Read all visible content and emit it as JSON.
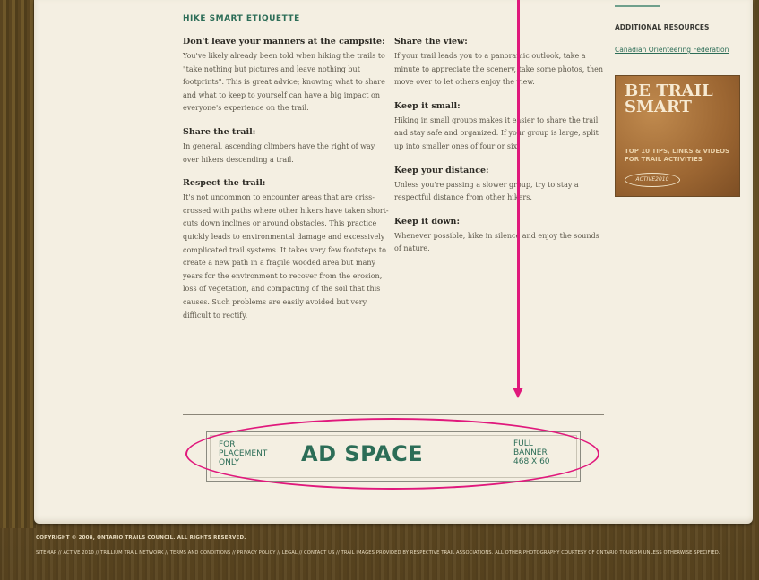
{
  "main": {
    "section_title": "HIKE SMART ETIQUETTE",
    "col1": [
      {
        "heading": "Don't leave your manners at the campsite:",
        "text": "You've likely already been told when hiking the trails to \"take nothing but pictures and leave nothing but footprints\". This is great advice; knowing what to share and what to keep to yourself can have a big impact on everyone's experience on the trail."
      },
      {
        "heading": "Share the trail:",
        "text": "In general, ascending climbers have the right of way over hikers descending a trail."
      },
      {
        "heading": "Respect the trail:",
        "text": "It's not uncommon to encounter areas that are criss-crossed with paths where other hikers have taken short-cuts down inclines or around obstacles. This practice quickly leads to environmental damage and excessively complicated trail systems. It takes very few footsteps to create a new path in a fragile wooded area but many years for the environment to recover from the erosion, loss of vegetation, and compacting of the soil that this causes. Such problems are easily avoided but very difficult to rectify."
      }
    ],
    "col2": [
      {
        "heading": "Share the view:",
        "text": "If your trail leads you to a panoramic outlook, take a minute to appreciate the scenery, take some photos, then move over to let others enjoy the view."
      },
      {
        "heading": "Keep it small:",
        "text": "Hiking in small groups makes it easier to share the trail and stay safe and organized. If your group is large, split up into smaller ones of four or six."
      },
      {
        "heading": "Keep your distance:",
        "text": "Unless you're passing a slower group, try to stay a respectful distance from other hikers."
      },
      {
        "heading": "Keep it down:",
        "text": "Whenever possible, hike in silence and enjoy the sounds of nature."
      }
    ]
  },
  "sidebar": {
    "title": "ADDITIONAL RESOURCES",
    "link": "Canadian Orienteering Federation",
    "promo": {
      "title_line1": "BE TRAIL",
      "title_line2": "SMART",
      "subtitle": "TOP 10 TIPS, LINKS & VIDEOS FOR TRAIL ACTIVITIES",
      "logo": "ACTIVE2010"
    }
  },
  "ad": {
    "left_line1": "FOR",
    "left_line2": "PLACEMENT",
    "left_line3": "ONLY",
    "main": "AD SPACE",
    "right_line1": "FULL",
    "right_line2": "BANNER",
    "right_line3": "468 X 60"
  },
  "footer": {
    "copyright": "COPYRIGHT © 2008, ONTARIO TRAILS COUNCIL. ALL RIGHTS RESERVED.",
    "links": "SITEMAP // ACTIVE 2010 // TRILLIUM TRAIL NETWORK // TERMS AND CONDITIONS // PRIVACY POLICY // LEGAL // CONTACT US // TRAIL IMAGES PROVIDED BY RESPECTIVE TRAIL ASSOCIATIONS. ALL OTHER PHOTOGRAPHY COURTESY OF ONTARIO TOURISM UNLESS OTHERWISE SPECIFIED."
  },
  "colors": {
    "accent_green": "#2c6d57",
    "annotation_magenta": "#e0187c",
    "paper": "#f4efe2"
  }
}
